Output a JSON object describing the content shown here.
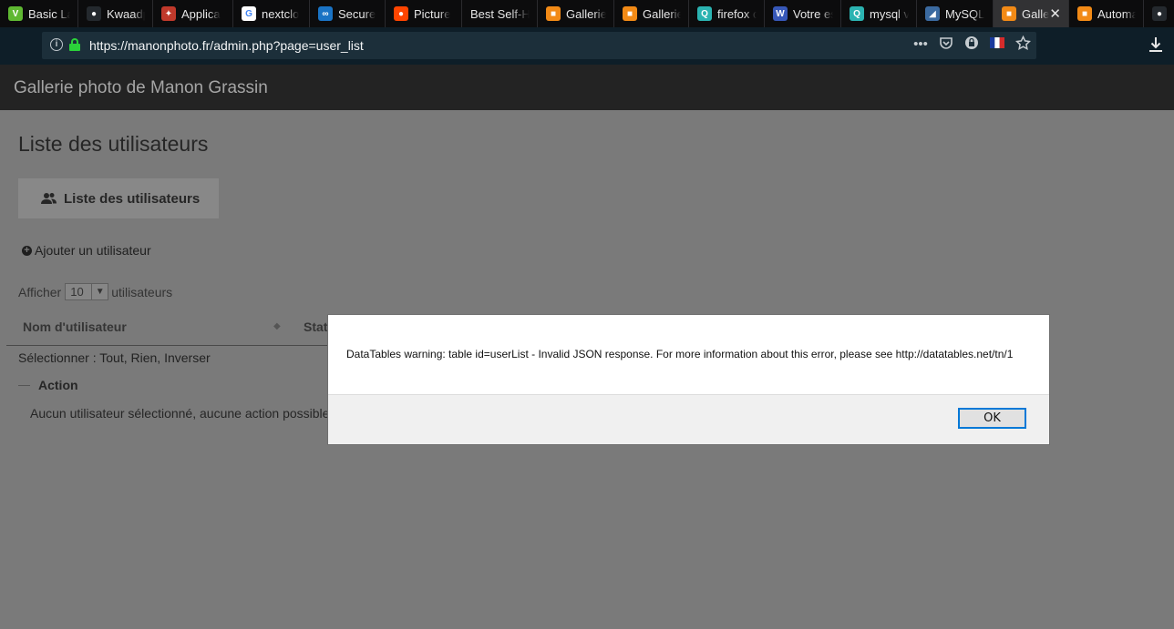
{
  "browser": {
    "tabs": [
      {
        "title": "Basic La",
        "fav_color": "#5fb832",
        "fav_glyph": "V"
      },
      {
        "title": "Kwaadp",
        "fav_color": "#24292e",
        "fav_glyph": "●"
      },
      {
        "title": "Applica",
        "fav_color": "#c0392b",
        "fav_glyph": "✦"
      },
      {
        "title": "nextclo",
        "fav_color": "#ffffff",
        "fav_glyph": "G"
      },
      {
        "title": "Secure",
        "fav_color": "#1a73c4",
        "fav_glyph": "∞"
      },
      {
        "title": "Picture",
        "fav_color": "#ff4500",
        "fav_glyph": "●"
      },
      {
        "title": "Best Self-H",
        "fav_color": "",
        "fav_glyph": ""
      },
      {
        "title": "Gallerie",
        "fav_color": "#f28a16",
        "fav_glyph": "■"
      },
      {
        "title": "Gallerie",
        "fav_color": "#f28a16",
        "fav_glyph": "■"
      },
      {
        "title": "firefox c",
        "fav_color": "#2bb3b1",
        "fav_glyph": "Q"
      },
      {
        "title": "Votre es",
        "fav_color": "#3758b8",
        "fav_glyph": "W"
      },
      {
        "title": "mysql v",
        "fav_color": "#2bb3b1",
        "fav_glyph": "Q"
      },
      {
        "title": "MySQL",
        "fav_color": "#3b6aa0",
        "fav_glyph": "◢"
      },
      {
        "title": "Galle",
        "fav_color": "#f28a16",
        "fav_glyph": "■",
        "active": true
      },
      {
        "title": "Automa",
        "fav_color": "#f28a16",
        "fav_glyph": "■"
      },
      {
        "title": "n",
        "fav_color": "#24292e",
        "fav_glyph": "●"
      }
    ],
    "url": "https://manonphoto.fr/admin.php?page=user_list",
    "actions": [
      "more-icon",
      "pocket-icon",
      "shield-icon",
      "flag-icon",
      "star-icon"
    ]
  },
  "page": {
    "site_title": "Gallerie photo de Manon Grassin",
    "title": "Liste des utilisateurs",
    "tab_label": "Liste des utilisateurs",
    "add_user": "Ajouter un utilisateur",
    "show_prefix": "Afficher",
    "show_value": "10",
    "show_suffix": "utilisateurs",
    "col_username": "Nom d'utilisateur",
    "col_status": "Stat",
    "select_label": "Sélectionner :",
    "select_all": "Tout",
    "select_none": "Rien",
    "select_invert": "Inverser",
    "action_legend": "Action",
    "no_action": "Aucun utilisateur sélectionné, aucune action possible."
  },
  "modal": {
    "message": "DataTables warning: table id=userList - Invalid JSON response. For more information about this error, please see http://datatables.net/tn/1",
    "ok_label": "OK"
  }
}
